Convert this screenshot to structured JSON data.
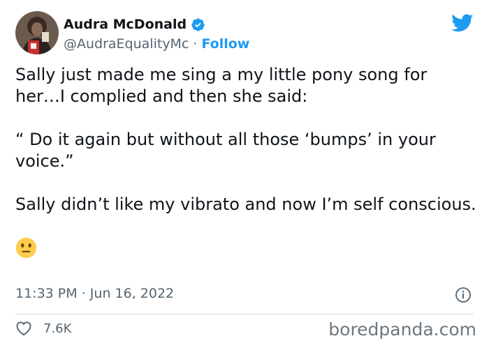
{
  "tweet": {
    "author": {
      "name": "Audra McDonald",
      "handle": "@AudraEqualityMc",
      "separator": "·",
      "follow_label": "Follow",
      "verified": true
    },
    "paragraphs": [
      "Sally just made me sing a my little pony song for her…I complied and then she said:",
      "“ Do it again but without all those ‘bumps’ in your voice.”",
      "Sally didn’t like my vibrato and now I’m self conscious."
    ],
    "emoji": "neutral-face-emoji",
    "time": "11:33 PM",
    "date_separator": "·",
    "date": "Jun 16, 2022",
    "likes": "7.6K"
  },
  "watermark": "boredpanda.com",
  "icons": {
    "platform": "twitter-bird-icon",
    "verified": "verified-badge-icon",
    "info": "info-icon",
    "like": "heart-icon"
  },
  "colors": {
    "accent": "#1d9bf0",
    "text": "#0f1419",
    "secondary": "#536471",
    "divider": "#cfd9de"
  }
}
